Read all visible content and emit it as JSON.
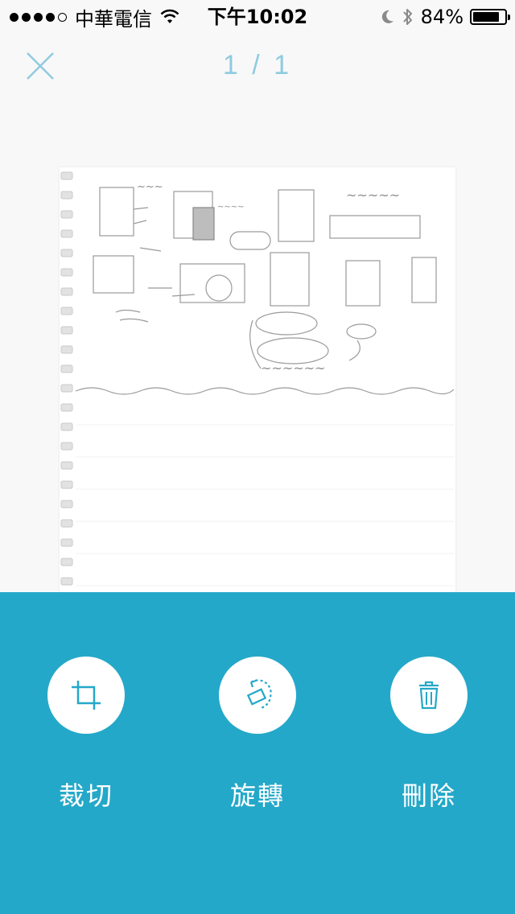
{
  "status_bar": {
    "carrier": "中華電信",
    "time": "下午10:02",
    "battery_percent_text": "84%",
    "battery_level": 0.84,
    "signal_bars_filled": 4,
    "signal_bars_total": 5
  },
  "header": {
    "page_indicator": "1 / 1",
    "close_icon": "close-icon"
  },
  "actions": [
    {
      "id": "crop",
      "label": "裁切",
      "icon": "crop-icon"
    },
    {
      "id": "rotate",
      "label": "旋轉",
      "icon": "rotate-icon"
    },
    {
      "id": "delete",
      "label": "刪除",
      "icon": "trash-icon"
    }
  ],
  "colors": {
    "accent": "#24a8c9",
    "page_indicator": "#8fcbe0",
    "close_icon": "#8fcbe0",
    "background": "#f8f8f8"
  }
}
